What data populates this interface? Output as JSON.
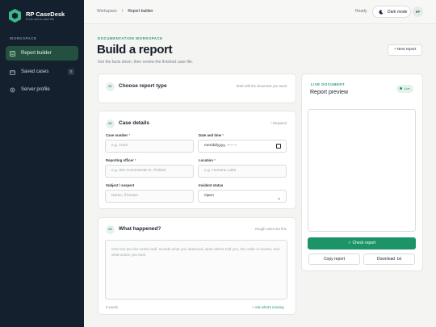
{
  "app": {
    "name": "RP CaseDesk",
    "tagline": "From call to case file"
  },
  "sidebar": {
    "section_label": "WORKSPACE",
    "items": [
      {
        "label": "Report builder",
        "icon": "document-icon",
        "active": true
      },
      {
        "label": "Saved cases",
        "icon": "folder-icon",
        "count": "0"
      },
      {
        "label": "Server profile",
        "icon": "gear-icon"
      }
    ]
  },
  "header": {
    "breadcrumb": [
      "Workspace",
      "/",
      "Report builder"
    ],
    "status": "Ready",
    "dark_mode_label": "Dark mode",
    "avatar_initials": "RP"
  },
  "page": {
    "eyebrow": "DOCUMENTATION WORKSPACE",
    "title": "Build a report",
    "subtitle": "Get the facts down, then review the finished case file.",
    "new_report_label": "+ New report"
  },
  "steps": {
    "type": {
      "number": "01",
      "title": "Choose report type",
      "meta": "Start with the document you need"
    },
    "details": {
      "number": "02",
      "title": "Case details",
      "meta": "* Required",
      "fields": {
        "case_number": {
          "label": "Case number",
          "required": "*",
          "placeholder": "e.g. 1043"
        },
        "datetime": {
          "label": "Date and time",
          "required": "*",
          "value": "mm/dd/yyyy, --:-- --"
        },
        "officer": {
          "label": "Reporting officer",
          "required": "*",
          "placeholder": "e.g. 001 Commander E. Pickles"
        },
        "location": {
          "label": "Location",
          "required": "*",
          "placeholder": "e.g. Humane Labs"
        },
        "subject": {
          "label": "Subject / suspect",
          "placeholder": "Name, if known"
        },
        "incident_status": {
          "label": "Incident status",
          "value": "Open"
        }
      }
    },
    "narrative": {
      "number": "03",
      "title": "What happened?",
      "meta": "Rough notes are fine",
      "placeholder": "One fact per line works well. Include what you observed, what others told you, the order of events, and what action you took.",
      "word_count": "0 words",
      "missing_link": "+ Ask what's missing"
    }
  },
  "preview": {
    "eyebrow": "LIVE DOCUMENT",
    "title": "Report preview",
    "live_badge": "Live",
    "check_label": "✓ Check report",
    "copy_label": "Copy report",
    "download_label": "Download .txt"
  },
  "colors": {
    "accent": "#1d9468",
    "sidebar": "#14202d",
    "active_nav": "#24503f"
  }
}
